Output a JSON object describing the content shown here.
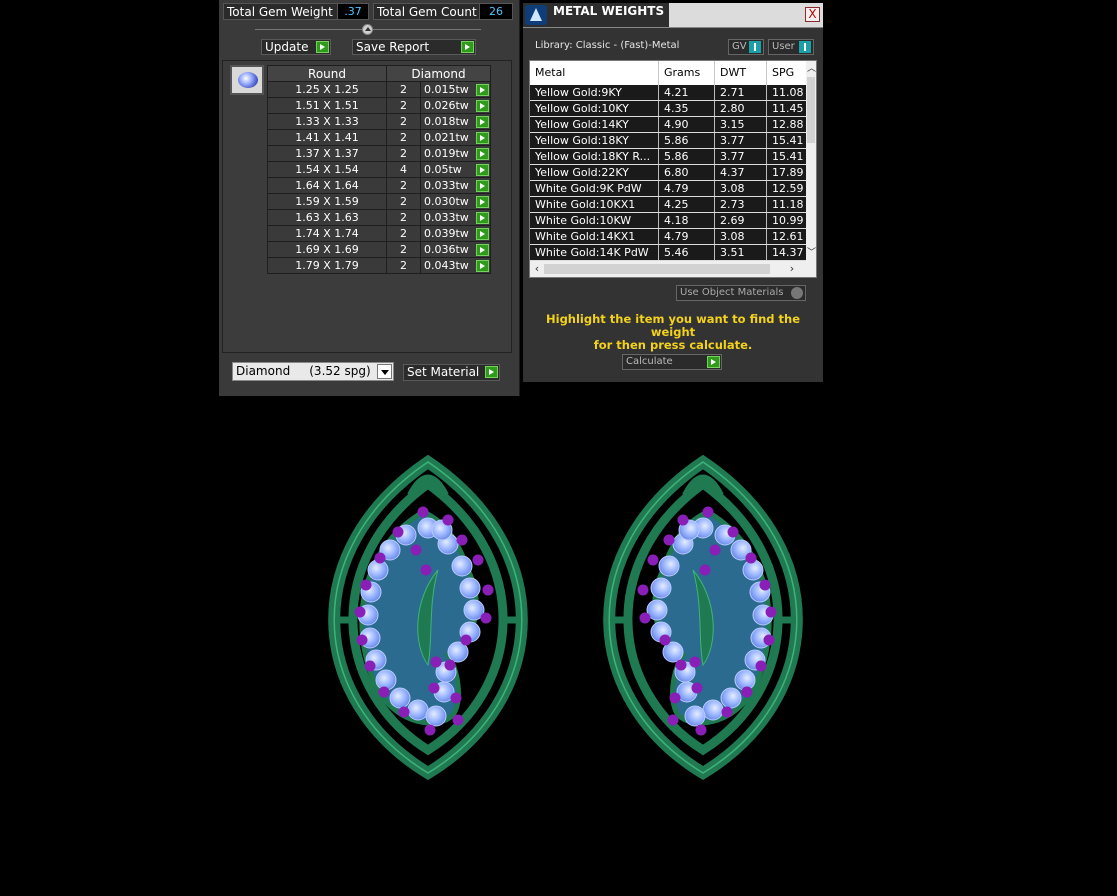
{
  "gem_panel": {
    "total_weight_label": "Total Gem Weight",
    "total_weight_value": ".37",
    "total_count_label": "Total Gem Count",
    "total_count_value": "26",
    "update_label": "Update",
    "save_report_label": "Save Report",
    "table": {
      "headers": [
        "Round",
        "Diamond"
      ],
      "rows": [
        {
          "size": "1.25 X 1.25",
          "qty": "2",
          "weight": "0.015tw"
        },
        {
          "size": "1.51 X 1.51",
          "qty": "2",
          "weight": "0.026tw"
        },
        {
          "size": "1.33 X 1.33",
          "qty": "2",
          "weight": "0.018tw"
        },
        {
          "size": "1.41 X 1.41",
          "qty": "2",
          "weight": "0.021tw"
        },
        {
          "size": "1.37 X 1.37",
          "qty": "2",
          "weight": "0.019tw"
        },
        {
          "size": "1.54 X 1.54",
          "qty": "4",
          "weight": "0.05tw"
        },
        {
          "size": "1.64 X 1.64",
          "qty": "2",
          "weight": "0.033tw"
        },
        {
          "size": "1.59 X 1.59",
          "qty": "2",
          "weight": "0.030tw"
        },
        {
          "size": "1.63 X 1.63",
          "qty": "2",
          "weight": "0.033tw"
        },
        {
          "size": "1.74 X 1.74",
          "qty": "2",
          "weight": "0.039tw"
        },
        {
          "size": "1.69 X 1.69",
          "qty": "2",
          "weight": "0.036tw"
        },
        {
          "size": "1.79 X 1.79",
          "qty": "2",
          "weight": "0.043tw"
        }
      ]
    },
    "material_select_value": "Diamond     (3.52 spg)",
    "set_material_label": "Set Material"
  },
  "metal_panel": {
    "title": "METAL WEIGHTS",
    "close_label": "X",
    "library_label": "Library: Classic - (Fast)-Metal",
    "gv_label": "GV",
    "user_label": "User",
    "columns": [
      "Metal",
      "Grams",
      "DWT",
      "SPG"
    ],
    "rows": [
      {
        "metal": "Yellow Gold:9KY",
        "grams": "4.21",
        "dwt": "2.71",
        "spg": "11.08"
      },
      {
        "metal": "Yellow Gold:10KY",
        "grams": "4.35",
        "dwt": "2.80",
        "spg": "11.45"
      },
      {
        "metal": "Yellow Gold:14KY",
        "grams": "4.90",
        "dwt": "3.15",
        "spg": "12.88"
      },
      {
        "metal": "Yellow Gold:18KY",
        "grams": "5.86",
        "dwt": "3.77",
        "spg": "15.41"
      },
      {
        "metal": "Yellow Gold:18KY R...",
        "grams": "5.86",
        "dwt": "3.77",
        "spg": "15.41"
      },
      {
        "metal": "Yellow Gold:22KY",
        "grams": "6.80",
        "dwt": "4.37",
        "spg": "17.89"
      },
      {
        "metal": "White Gold:9K PdW",
        "grams": "4.79",
        "dwt": "3.08",
        "spg": "12.59"
      },
      {
        "metal": "White Gold:10KX1",
        "grams": "4.25",
        "dwt": "2.73",
        "spg": "11.18"
      },
      {
        "metal": "White Gold:10KW",
        "grams": "4.18",
        "dwt": "2.69",
        "spg": "10.99"
      },
      {
        "metal": "White Gold:14KX1",
        "grams": "4.79",
        "dwt": "3.08",
        "spg": "12.61"
      },
      {
        "metal": "White Gold:14K PdW",
        "grams": "5.46",
        "dwt": "3.51",
        "spg": "14.37"
      }
    ],
    "use_object_materials_label": "Use Object Materials",
    "hint_line1": "Highlight the item you want to find the weight",
    "hint_line2": "for then press calculate.",
    "calculate_label": "Calculate"
  },
  "colors": {
    "metal": "#1f7a52",
    "stone": "#9bb6ff",
    "prong": "#8a1fb8",
    "hint": "#f3d21b",
    "go_button": "#2f9a1c"
  },
  "icons": [
    "collapse-arrow-icon",
    "play-icon",
    "close-icon",
    "dropdown-arrow-icon",
    "gem-thumbnail-icon",
    "app-logo-icon"
  ]
}
